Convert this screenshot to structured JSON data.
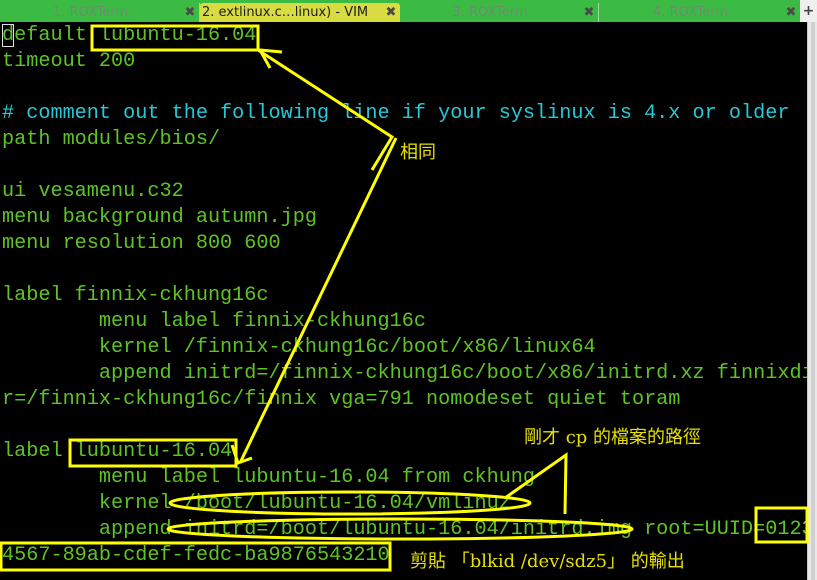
{
  "tabs": [
    {
      "label": "1. ROXTerm",
      "active": false
    },
    {
      "label": "2. extlinux.c…linux) - VIM",
      "active": true
    },
    {
      "label": "3. ROXTerm",
      "active": false
    },
    {
      "label": "4. ROXTerm",
      "active": false
    }
  ],
  "tab_close_glyph": "✖",
  "new_tab_glyph": "+",
  "editor": {
    "lines": [
      {
        "text": "default lubuntu-16.04",
        "type": "normal"
      },
      {
        "text": "timeout 200",
        "type": "normal"
      },
      {
        "text": "",
        "type": "normal"
      },
      {
        "text": "# comment out the following line if your syslinux is 4.x or older",
        "type": "comment"
      },
      {
        "text": "path modules/bios/",
        "type": "normal"
      },
      {
        "text": "",
        "type": "normal"
      },
      {
        "text": "ui vesamenu.c32",
        "type": "normal"
      },
      {
        "text": "menu background autumn.jpg",
        "type": "normal"
      },
      {
        "text": "menu resolution 800 600",
        "type": "normal"
      },
      {
        "text": "",
        "type": "normal"
      },
      {
        "text": "label finnix-ckhung16c",
        "type": "normal"
      },
      {
        "text": "        menu label finnix-ckhung16c",
        "type": "normal"
      },
      {
        "text": "        kernel /finnix-ckhung16c/boot/x86/linux64",
        "type": "normal"
      },
      {
        "text": "        append initrd=/finnix-ckhung16c/boot/x86/initrd.xz finnixdi",
        "type": "normal"
      },
      {
        "text": "r=/finnix-ckhung16c/finnix vga=791 nomodeset quiet toram",
        "type": "normal"
      },
      {
        "text": "",
        "type": "normal"
      },
      {
        "text": "label lubuntu-16.04",
        "type": "normal"
      },
      {
        "text": "        menu label lubuntu-16.04 from ckhung",
        "type": "normal"
      },
      {
        "text": "        kernel /boot/lubuntu-16.04/vmlinuz",
        "type": "normal"
      },
      {
        "text": "        append initrd=/boot/lubuntu-16.04/initrd.img root=UUID=0123",
        "type": "normal"
      },
      {
        "text": "4567-89ab-cdef-fedc-ba9876543210",
        "type": "normal"
      }
    ]
  },
  "annotations": {
    "same": "相同",
    "cp_path": "剛才 cp 的檔案的路徑",
    "paste_blkid": "剪貼 「blkid /dev/sdz5」 的輸出"
  },
  "colors": {
    "tabbar": "#3cbb44",
    "active_tab": "#d8dc40",
    "text": "#5dc424",
    "comment": "#27c8d8",
    "annotation": "#ffff00"
  }
}
